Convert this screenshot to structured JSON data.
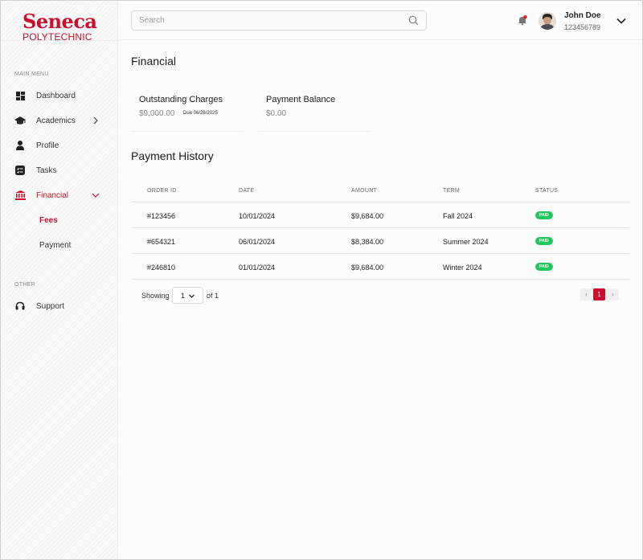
{
  "brand": {
    "name": "Seneca",
    "sub": "POLYTECHNIC",
    "color": "#c8102e"
  },
  "sidebar": {
    "main_menu_label": "MAIN MENU",
    "items": [
      {
        "label": "Dashboard",
        "icon": "dashboard-icon"
      },
      {
        "label": "Academics",
        "icon": "graduation-cap-icon"
      },
      {
        "label": "Profile",
        "icon": "user-icon"
      },
      {
        "label": "Tasks",
        "icon": "tasks-icon"
      },
      {
        "label": "Financial",
        "icon": "bank-icon",
        "active": true
      }
    ],
    "sub_items": [
      {
        "label": "Fees",
        "active": true
      },
      {
        "label": "Payment"
      }
    ],
    "other_label": "OTHER",
    "other_items": [
      {
        "label": "Support",
        "icon": "headset-icon"
      }
    ]
  },
  "header": {
    "search_placeholder": "Search",
    "user": {
      "name": "John Doe",
      "id": "123456789"
    }
  },
  "main": {
    "title": "Financial",
    "cards": [
      {
        "title": "Outstanding Charges",
        "value": "$9,000.00",
        "due": "Due 06/28/2025"
      },
      {
        "title": "Payment Balance",
        "value": "$0.00"
      }
    ],
    "history_title": "Payment History",
    "columns": [
      "ORDER ID",
      "DATE",
      "AMOUNT",
      "TERM",
      "STATUS"
    ],
    "rows": [
      {
        "order_id": "#123456",
        "date": "10/01/2024",
        "amount": "$9,684.00",
        "term": "Fall 2024",
        "status": "PAID"
      },
      {
        "order_id": "#654321",
        "date": "06/01/2024",
        "amount": "$8,384.00",
        "term": "Summer 2024",
        "status": "PAID"
      },
      {
        "order_id": "#246810",
        "date": "01/01/2024",
        "amount": "$9,684.00",
        "term": "Winter 2024",
        "status": "PAID"
      }
    ],
    "pagination": {
      "showing_label": "Showing",
      "page": "1",
      "of_label": "of 1",
      "current": "1",
      "prev": "‹",
      "next": "›"
    }
  },
  "colors": {
    "paid": "#22c55e",
    "accent": "#c8102e"
  }
}
